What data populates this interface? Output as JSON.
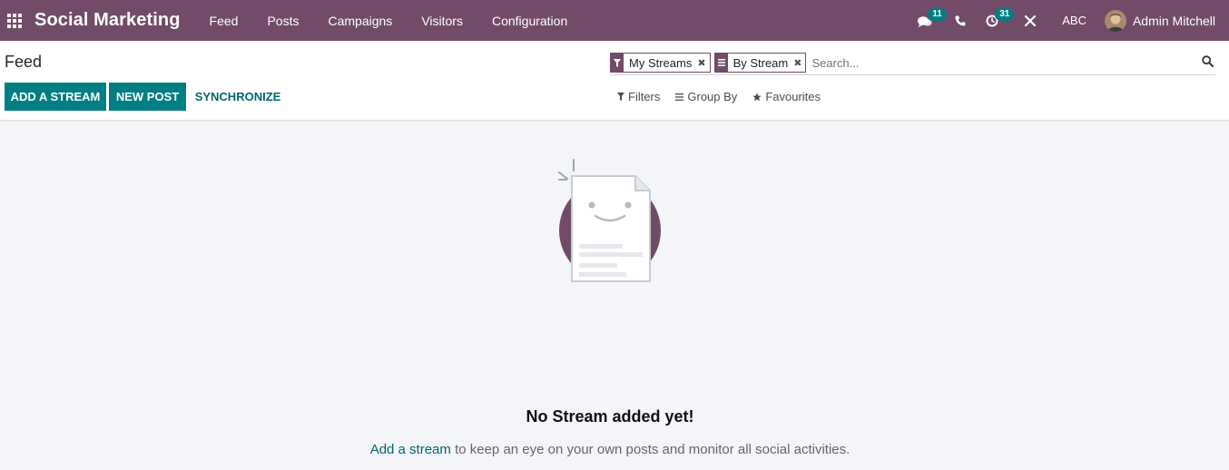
{
  "navbar": {
    "brand": "Social Marketing",
    "menu": [
      "Feed",
      "Posts",
      "Campaigns",
      "Visitors",
      "Configuration"
    ],
    "messages_count": "11",
    "activities_count": "31",
    "company": "ABC",
    "user_name": "Admin Mitchell"
  },
  "control": {
    "title": "Feed",
    "buttons": {
      "add_stream": "ADD A STREAM",
      "new_post": "NEW POST",
      "synchronize": "SYNCHRONIZE"
    },
    "search": {
      "facets": [
        "My Streams",
        "By Stream"
      ],
      "placeholder": "Search..."
    },
    "filters": {
      "filters_label": "Filters",
      "group_by_label": "Group By",
      "favourites_label": "Favourites"
    }
  },
  "empty_state": {
    "title": "No Stream added yet!",
    "link_text": "Add a stream",
    "text": " to keep an eye on your own posts and monitor all social activities."
  },
  "colors": {
    "brand": "#714b67",
    "accent": "#017e84"
  }
}
